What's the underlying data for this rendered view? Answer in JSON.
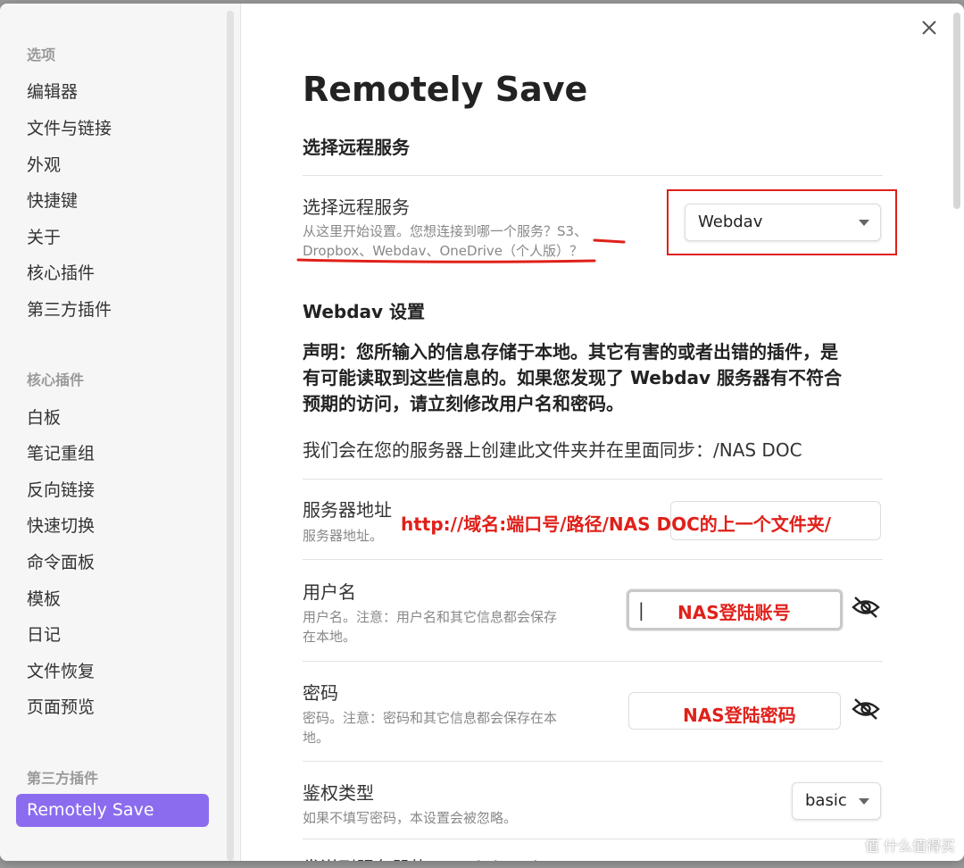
{
  "sidebar": {
    "sections": [
      {
        "heading": "选项",
        "items": [
          "编辑器",
          "文件与链接",
          "外观",
          "快捷键",
          "关于",
          "核心插件",
          "第三方插件"
        ]
      },
      {
        "heading": "核心插件",
        "items": [
          "白板",
          "笔记重组",
          "反向链接",
          "快速切换",
          "命令面板",
          "模板",
          "日记",
          "文件恢复",
          "页面预览"
        ]
      },
      {
        "heading": "第三方插件",
        "items": []
      }
    ],
    "active_item": "Remotely Save"
  },
  "main": {
    "title": "Remotely Save",
    "section_remote": "选择远程服务",
    "remote_setting": {
      "name": "选择远程服务",
      "desc_line1": "从这里开始设置。您想连接到哪一个服务？S3、",
      "desc_line2": "Dropbox、Webdav、OneDrive（个人版）？",
      "selected": "Webdav"
    },
    "section_webdav": "Webdav 设置",
    "disclaimer": [
      "声明：您所输入的信息存储于本地。其它有害的或者出错的插件，是",
      "有可能读取到这些信息的。如果您发现了 Webdav 服务器有不符合",
      "预期的访问，请立刻修改用户名和密码。"
    ],
    "sync_folder_note": "我们会在您的服务器上创建此文件夹并在里面同步：/NAS DOC",
    "server": {
      "name": "服务器地址",
      "desc": "服务器地址。",
      "annotation": "http://域名:端口号/路径/NAS DOC的上一个文件夹/"
    },
    "username": {
      "name": "用户名",
      "desc_line1": "用户名。注意：用户名和其它信息都会保存",
      "desc_line2": "在本地。",
      "annotation": "NAS登陆账号",
      "cursor": "|"
    },
    "password": {
      "name": "密码",
      "desc_line1": "密码。注意：密码和其它信息都会保存在本",
      "desc_line2": "地。",
      "annotation": "NAS登陆密码"
    },
    "auth": {
      "name": "鉴权类型",
      "desc": "如果不填写密码，本设置会被忽略。",
      "selected": "basic"
    },
    "next_partial": "发送到服务器的 Depth header"
  },
  "watermark": "值 什么值得买",
  "colors": {
    "accent": "#8b6cef",
    "annotation_red": "#e0201a"
  }
}
